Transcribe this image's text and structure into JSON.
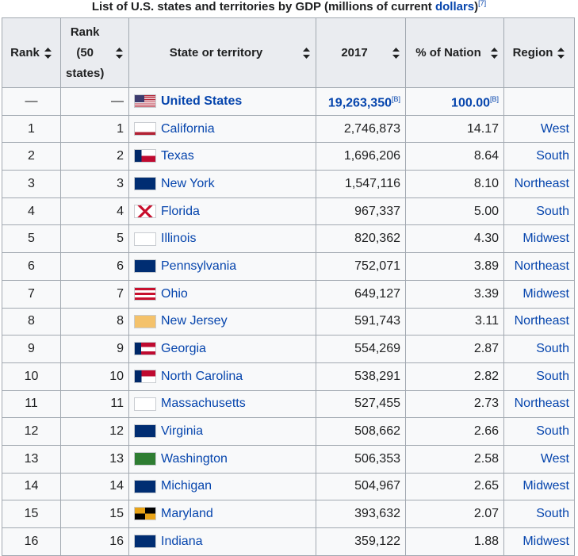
{
  "caption": {
    "text": "List of U.S. states and territories by GDP (millions of current ",
    "link": "dollars",
    "close": ")",
    "ref": "[7]"
  },
  "headers": {
    "rank": "Rank",
    "rank50_a": "Rank",
    "rank50_b": "(50",
    "rank50_c": "states)",
    "state": "State or territory",
    "gdp": "2017",
    "pct": "% of Nation",
    "region": "Region"
  },
  "total_row": {
    "rank": "—",
    "rank50": "—",
    "state": "United States",
    "gdp": "19,263,350",
    "gdp_ref": "[B]",
    "pct": "100.00",
    "pct_ref": "[B]",
    "region": ""
  },
  "rows": [
    {
      "rank": "1",
      "rank50": "1",
      "state": "California",
      "gdp": "2,746,873",
      "pct": "14.17",
      "region": "West"
    },
    {
      "rank": "2",
      "rank50": "2",
      "state": "Texas",
      "gdp": "1,696,206",
      "pct": "8.64",
      "region": "South"
    },
    {
      "rank": "3",
      "rank50": "3",
      "state": "New York",
      "gdp": "1,547,116",
      "pct": "8.10",
      "region": "Northeast"
    },
    {
      "rank": "4",
      "rank50": "4",
      "state": "Florida",
      "gdp": "967,337",
      "pct": "5.00",
      "region": "South"
    },
    {
      "rank": "5",
      "rank50": "5",
      "state": "Illinois",
      "gdp": "820,362",
      "pct": "4.30",
      "region": "Midwest"
    },
    {
      "rank": "6",
      "rank50": "6",
      "state": "Pennsylvania",
      "gdp": "752,071",
      "pct": "3.89",
      "region": "Northeast"
    },
    {
      "rank": "7",
      "rank50": "7",
      "state": "Ohio",
      "gdp": "649,127",
      "pct": "3.39",
      "region": "Midwest"
    },
    {
      "rank": "8",
      "rank50": "8",
      "state": "New Jersey",
      "gdp": "591,743",
      "pct": "3.11",
      "region": "Northeast"
    },
    {
      "rank": "9",
      "rank50": "9",
      "state": "Georgia",
      "gdp": "554,269",
      "pct": "2.87",
      "region": "South"
    },
    {
      "rank": "10",
      "rank50": "10",
      "state": "North Carolina",
      "gdp": "538,291",
      "pct": "2.82",
      "region": "South"
    },
    {
      "rank": "11",
      "rank50": "11",
      "state": "Massachusetts",
      "gdp": "527,455",
      "pct": "2.73",
      "region": "Northeast"
    },
    {
      "rank": "12",
      "rank50": "12",
      "state": "Virginia",
      "gdp": "508,662",
      "pct": "2.66",
      "region": "South"
    },
    {
      "rank": "13",
      "rank50": "13",
      "state": "Washington",
      "gdp": "506,353",
      "pct": "2.58",
      "region": "West"
    },
    {
      "rank": "14",
      "rank50": "14",
      "state": "Michigan",
      "gdp": "504,967",
      "pct": "2.65",
      "region": "Midwest"
    },
    {
      "rank": "15",
      "rank50": "15",
      "state": "Maryland",
      "gdp": "393,632",
      "pct": "2.07",
      "region": "South"
    },
    {
      "rank": "16",
      "rank50": "16",
      "state": "Indiana",
      "gdp": "359,122",
      "pct": "1.88",
      "region": "Midwest"
    }
  ],
  "flags": [
    "california-flag-icon",
    "texas-flag-icon",
    "new-york-flag-icon",
    "florida-flag-icon",
    "illinois-flag-icon",
    "pennsylvania-flag-icon",
    "ohio-flag-icon",
    "new-jersey-flag-icon",
    "georgia-flag-icon",
    "north-carolina-flag-icon",
    "massachusetts-flag-icon",
    "virginia-flag-icon",
    "washington-flag-icon",
    "michigan-flag-icon",
    "maryland-flag-icon",
    "indiana-flag-icon"
  ],
  "colors": {
    "link": "#0645ad",
    "header_bg": "#eaecf0",
    "cell_bg": "#f8f9fa",
    "border": "#a2a9b1"
  }
}
